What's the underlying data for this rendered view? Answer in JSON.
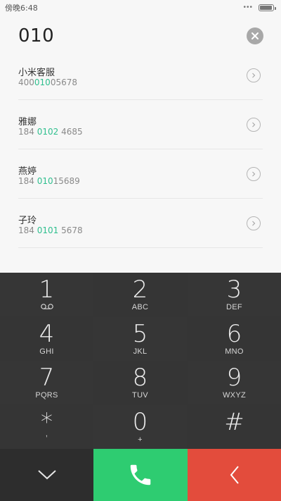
{
  "status_bar": {
    "time": "傍晚6:48",
    "dots": "•••",
    "battery_percent": 95
  },
  "dialer": {
    "input": "010"
  },
  "contacts": [
    {
      "name": "小米客服",
      "number_parts": [
        "400",
        "010",
        "05678"
      ]
    },
    {
      "name": "雅娜",
      "number_parts": [
        "184 ",
        "0102",
        " 4685"
      ]
    },
    {
      "name": "燕婷",
      "number_parts": [
        "184 ",
        "010",
        "15689"
      ]
    },
    {
      "name": "子玲",
      "number_parts": [
        "184 ",
        "0101",
        " 5678"
      ]
    }
  ],
  "keypad": [
    {
      "digit": "1",
      "letters": "",
      "icon": "voicemail-icon"
    },
    {
      "digit": "2",
      "letters": "ABC"
    },
    {
      "digit": "3",
      "letters": "DEF"
    },
    {
      "digit": "4",
      "letters": "GHI"
    },
    {
      "digit": "5",
      "letters": "JKL"
    },
    {
      "digit": "6",
      "letters": "MNO"
    },
    {
      "digit": "7",
      "letters": "PQRS"
    },
    {
      "digit": "8",
      "letters": "TUV"
    },
    {
      "digit": "9",
      "letters": "WXYZ"
    },
    {
      "digit": "*",
      "letters": ","
    },
    {
      "digit": "0",
      "letters": "+"
    },
    {
      "digit": "#",
      "letters": ""
    }
  ],
  "colors": {
    "highlight": "#2fbf8e",
    "call": "#2ecc71",
    "delete": "#e34c3c",
    "keypad_bg": "#353535"
  },
  "icons": {
    "clear": "clear-icon",
    "detail": "chevron-right-icon",
    "collapse": "chevron-down-icon",
    "call": "phone-icon",
    "delete": "backspace-icon"
  }
}
